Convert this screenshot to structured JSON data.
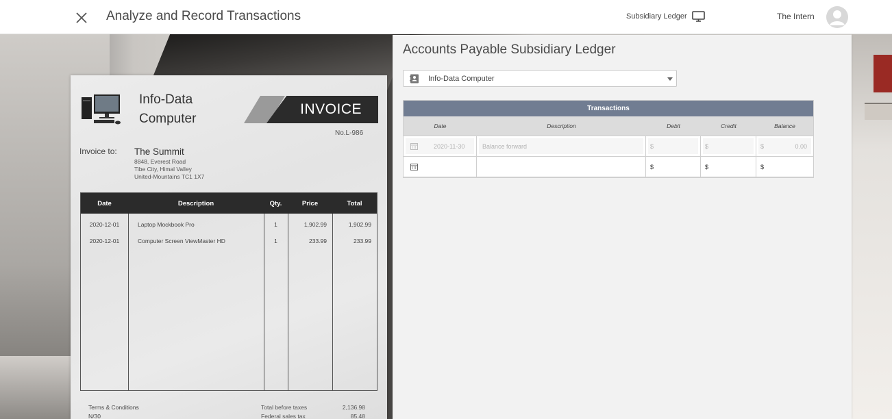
{
  "header": {
    "close_icon": "close-icon",
    "title": "Analyze and Record Transactions",
    "ledger_link_label": "Subsidiary Ledger",
    "ledger_link_icon": "monitor-icon",
    "user_name": "The Intern",
    "avatar_icon": "user-avatar-icon"
  },
  "invoice": {
    "company": "Info-Data Computer",
    "banner": "INVOICE",
    "number": "No.L-986",
    "to_label": "Invoice to:",
    "to_name": "The Summit",
    "address": [
      "8848, Everest Road",
      "Tibe City, Himal Valley",
      "United-Mountains TC1 1X7"
    ],
    "columns": [
      "Date",
      "Description",
      "Qty.",
      "Price",
      "Total"
    ],
    "rows": [
      {
        "date": "2020-12-01",
        "description": "Laptop Mockbook Pro",
        "qty": "1",
        "price": "1,902.99",
        "total": "1,902.99"
      },
      {
        "date": "2020-12-01",
        "description": "Computer Screen ViewMaster HD",
        "qty": "1",
        "price": "233.99",
        "total": "233.99"
      }
    ],
    "terms_title": "Terms & Conditions",
    "terms_value": "N/30",
    "totals": [
      {
        "label": "Total before taxes",
        "value": "2,136.98"
      },
      {
        "label": "Federal sales tax",
        "value": "85.48"
      }
    ]
  },
  "ledger": {
    "title": "Accounts Payable Subsidiary Ledger",
    "vendor": "Info-Data Computer",
    "vendor_icon": "contact-card-icon",
    "table_title": "Transactions",
    "columns": [
      "Date",
      "Description",
      "Debit",
      "Credit",
      "Balance"
    ],
    "rows": [
      {
        "date": "2020-11-30",
        "description": "Balance forward",
        "debit_symbol": "$",
        "credit_symbol": "$",
        "balance_symbol": "$",
        "balance": "0.00"
      },
      {
        "date": "",
        "description": "",
        "debit_symbol": "$",
        "credit_symbol": "$",
        "balance_symbol": "$",
        "balance": ""
      }
    ],
    "calendar_icon": "calendar-icon"
  },
  "colors": {
    "table_header": "#717d92",
    "invoice_header": "#2b2b2b"
  }
}
